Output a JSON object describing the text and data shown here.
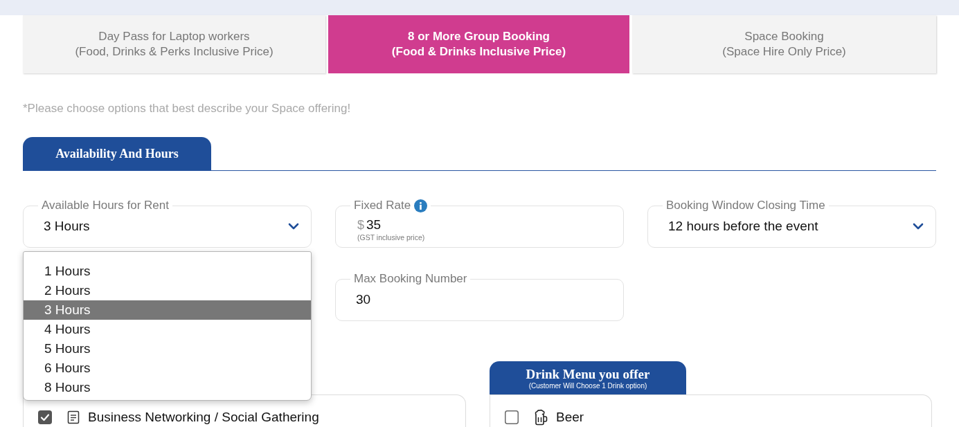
{
  "top_tabs": [
    {
      "title": "Day Pass for Laptop workers",
      "subtitle": "(Food, Drinks & Perks Inclusive Price)",
      "selected": false
    },
    {
      "title": "8 or More Group Booking",
      "subtitle": "(Food & Drinks Inclusive Price)",
      "selected": true
    },
    {
      "title": "Space Booking",
      "subtitle": "(Space Hire Only Price)",
      "selected": false
    }
  ],
  "note": "*Please choose options that best describe your Space offering!",
  "section": {
    "title": "Availability And Hours"
  },
  "fields": [
    {
      "kind": "select",
      "label": "Available Hours for Rent",
      "value": "3 Hours",
      "dropdown_options": [
        {
          "label": "1 Hours",
          "selected": false
        },
        {
          "label": "2 Hours",
          "selected": false
        },
        {
          "label": "3 Hours",
          "selected": true
        },
        {
          "label": "4 Hours",
          "selected": false
        },
        {
          "label": "5 Hours",
          "selected": false
        },
        {
          "label": "6 Hours",
          "selected": false
        },
        {
          "label": "8 Hours",
          "selected": false
        }
      ]
    },
    {
      "kind": "currency",
      "label": "Fixed Rate",
      "info": true,
      "prefix": "$",
      "value": "35",
      "hint": "(GST inclusive price)"
    },
    {
      "kind": "select",
      "label": "Booking Window Closing Time",
      "value": "12 hours before the event"
    },
    {
      "kind": "text",
      "label": "Max Booking Number",
      "value": "30"
    }
  ],
  "menus": [
    {
      "items": [
        {
          "label": "Business Networking / Social Gathering",
          "checked": true
        }
      ]
    },
    {
      "title": "Drink Menu you offer",
      "subtitle": "(Customer Will Choose 1 Drink option)",
      "items": [
        {
          "label": "Beer",
          "checked": false
        }
      ]
    }
  ]
}
